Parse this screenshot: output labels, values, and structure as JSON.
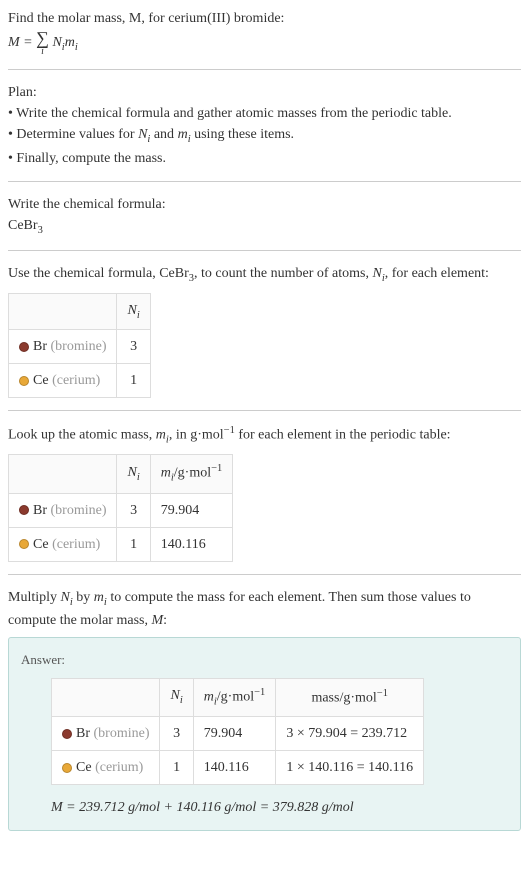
{
  "intro": {
    "line1": "Find the molar mass, M, for cerium(III) bromide:",
    "formula_lhs": "M = ",
    "sigma_sub": "i",
    "formula_rhs_a": "N",
    "formula_rhs_a_sub": "i",
    "formula_rhs_b": "m",
    "formula_rhs_b_sub": "i"
  },
  "plan": {
    "header": "Plan:",
    "b1": "• Write the chemical formula and gather atomic masses from the periodic table.",
    "b2_a": "• Determine values for ",
    "b2_n": "N",
    "b2_n_sub": "i",
    "b2_mid": " and ",
    "b2_m": "m",
    "b2_m_sub": "i",
    "b2_end": " using these items.",
    "b3": "• Finally, compute the mass."
  },
  "step1": {
    "text": "Write the chemical formula:",
    "formula_a": "CeBr",
    "formula_sub": "3"
  },
  "step2": {
    "text_a": "Use the chemical formula, CeBr",
    "formula_sub": "3",
    "text_b": ", to count the number of atoms, ",
    "n": "N",
    "n_sub": "i",
    "text_c": ", for each element:",
    "h_n": "N",
    "h_n_sub": "i",
    "rows": [
      {
        "el": "Br",
        "name": "(bromine)",
        "n": "3",
        "dot": "dot-br"
      },
      {
        "el": "Ce",
        "name": "(cerium)",
        "n": "1",
        "dot": "dot-ce"
      }
    ]
  },
  "step3": {
    "text_a": "Look up the atomic mass, ",
    "m": "m",
    "m_sub": "i",
    "text_b": ", in g·mol",
    "sup": "−1",
    "text_c": " for each element in the periodic table:",
    "h_n": "N",
    "h_n_sub": "i",
    "h_m": "m",
    "h_m_sub": "i",
    "h_m_unit": "/g·mol",
    "h_m_sup": "−1",
    "rows": [
      {
        "el": "Br",
        "name": "(bromine)",
        "n": "3",
        "m": "79.904",
        "dot": "dot-br"
      },
      {
        "el": "Ce",
        "name": "(cerium)",
        "n": "1",
        "m": "140.116",
        "dot": "dot-ce"
      }
    ]
  },
  "step4": {
    "text_a": "Multiply ",
    "n": "N",
    "n_sub": "i",
    "text_b": " by ",
    "m": "m",
    "m_sub": "i",
    "text_c": " to compute the mass for each element. Then sum those values to compute the molar mass, ",
    "mm": "M",
    "text_d": ":"
  },
  "answer": {
    "label": "Answer:",
    "h_n": "N",
    "h_n_sub": "i",
    "h_m": "m",
    "h_m_sub": "i",
    "h_m_unit": "/g·mol",
    "h_m_sup": "−1",
    "h_mass": "mass/g·mol",
    "h_mass_sup": "−1",
    "rows": [
      {
        "el": "Br",
        "name": "(bromine)",
        "n": "3",
        "m": "79.904",
        "mass": "3 × 79.904 = 239.712",
        "dot": "dot-br"
      },
      {
        "el": "Ce",
        "name": "(cerium)",
        "n": "1",
        "m": "140.116",
        "mass": "1 × 140.116 = 140.116",
        "dot": "dot-ce"
      }
    ],
    "final": "M = 239.712 g/mol + 140.116 g/mol = 379.828 g/mol"
  }
}
